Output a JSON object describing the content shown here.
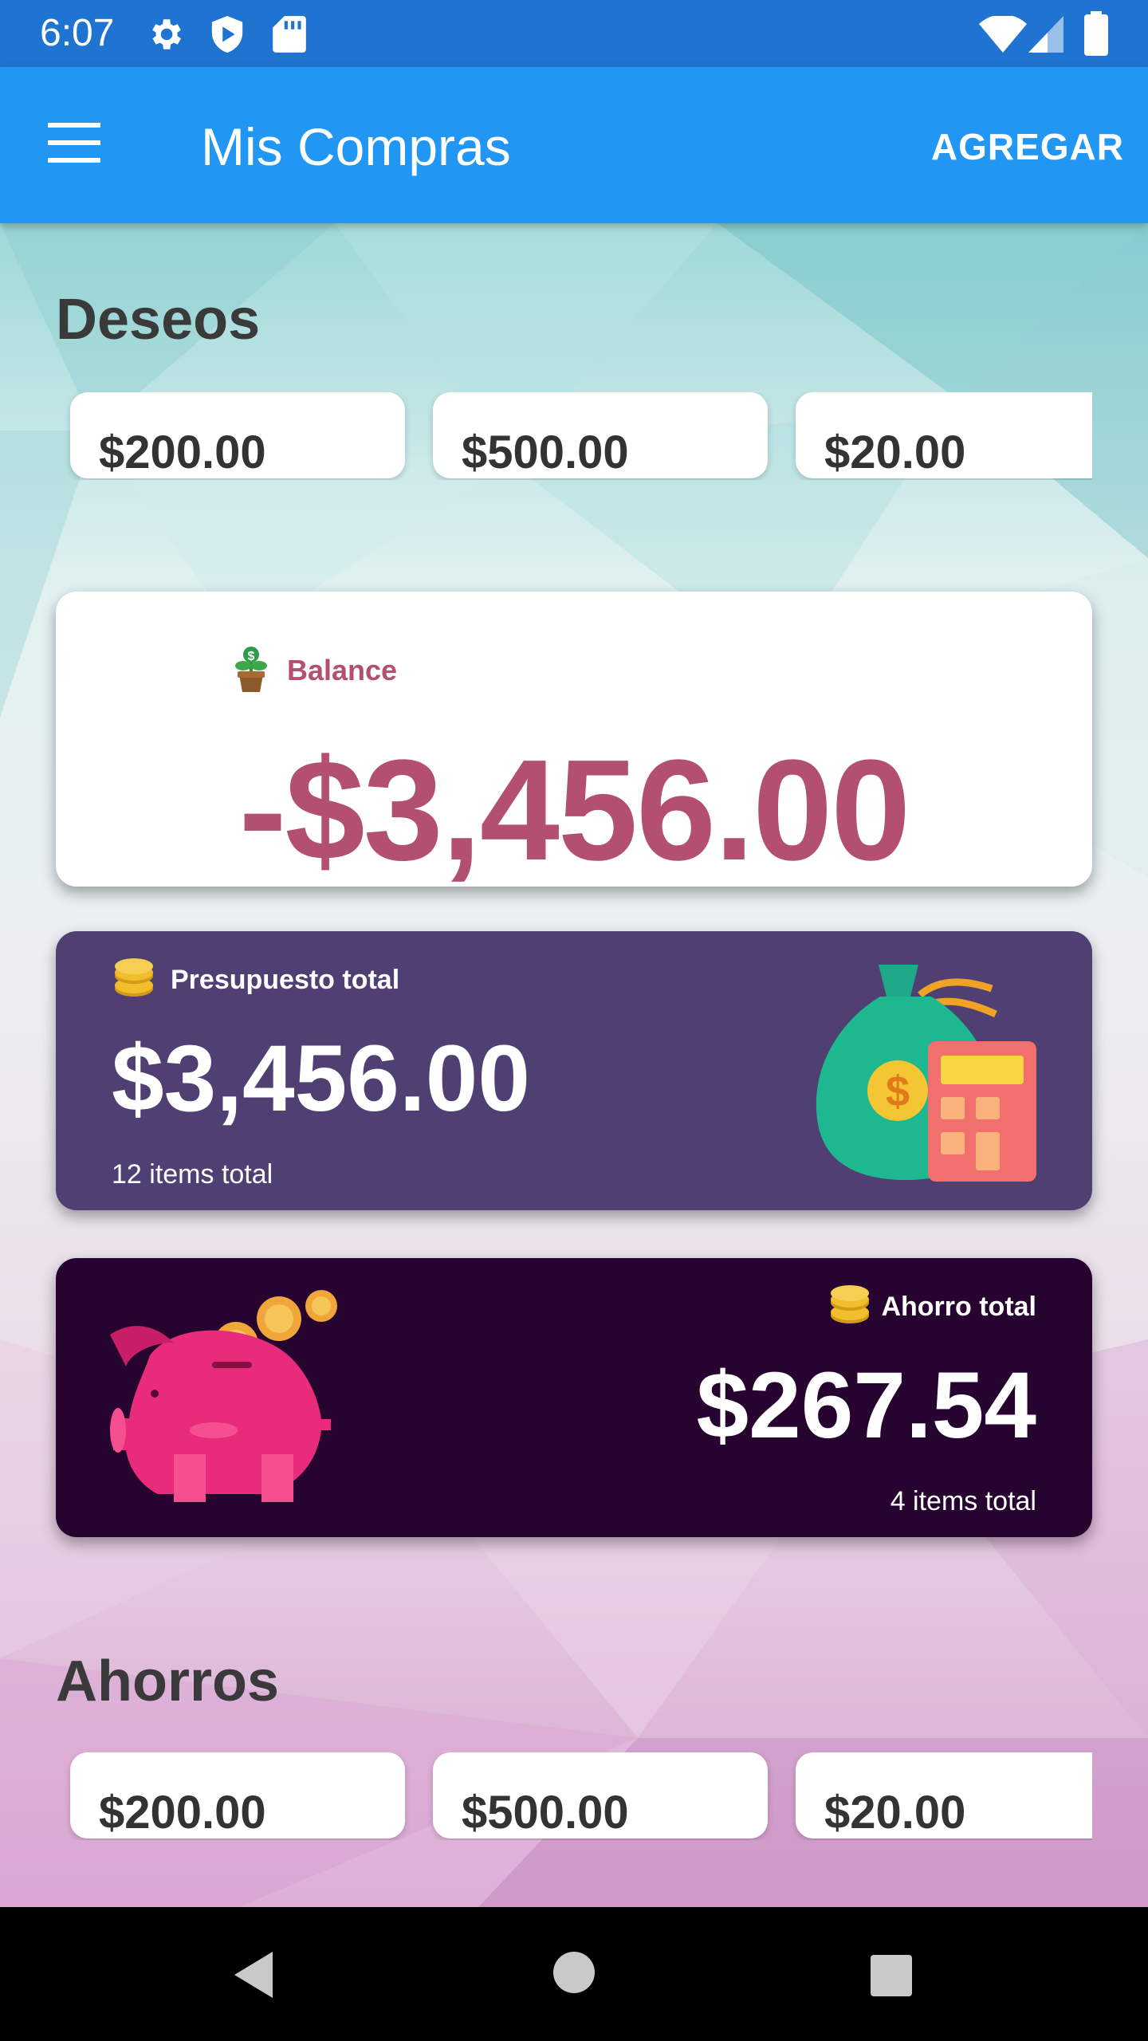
{
  "status_bar": {
    "time": "6:07",
    "icons": [
      "gear-icon",
      "play-shield-icon",
      "sd-card-icon",
      "wifi-icon",
      "signal-icon",
      "battery-icon"
    ]
  },
  "app_bar": {
    "title": "Mis Compras",
    "action_label": "AGREGAR",
    "menu_icon": "hamburger-menu-icon"
  },
  "deseos": {
    "title": "Deseos",
    "items": [
      {
        "amount": "$200.00"
      },
      {
        "amount": "$500.00"
      },
      {
        "amount": "$20.00"
      }
    ]
  },
  "balance": {
    "label": "Balance",
    "value": "-$3,456.00",
    "icon": "money-plant-icon"
  },
  "budget": {
    "label": "Presupuesto total",
    "value": "$3,456.00",
    "items_text": "12 items total",
    "icon": "coins-icon",
    "illustration": "money-bag-calculator-icon"
  },
  "savings": {
    "label": "Ahorro total",
    "value": "$267.54",
    "items_text": "4 items total",
    "icon": "coins-icon",
    "illustration": "piggy-bank-icon"
  },
  "ahorros": {
    "title": "Ahorros",
    "items": [
      {
        "amount": "$200.00"
      },
      {
        "amount": "$500.00"
      },
      {
        "amount": "$20.00"
      }
    ]
  },
  "nav_bar": {
    "buttons": [
      "back-icon",
      "home-icon",
      "recents-icon"
    ]
  },
  "colors": {
    "status_bar": "#1e74d0",
    "app_bar": "#2196f3",
    "balance_text": "#b34f70",
    "budget_card": "#4f3f73",
    "savings_card": "#270330"
  }
}
